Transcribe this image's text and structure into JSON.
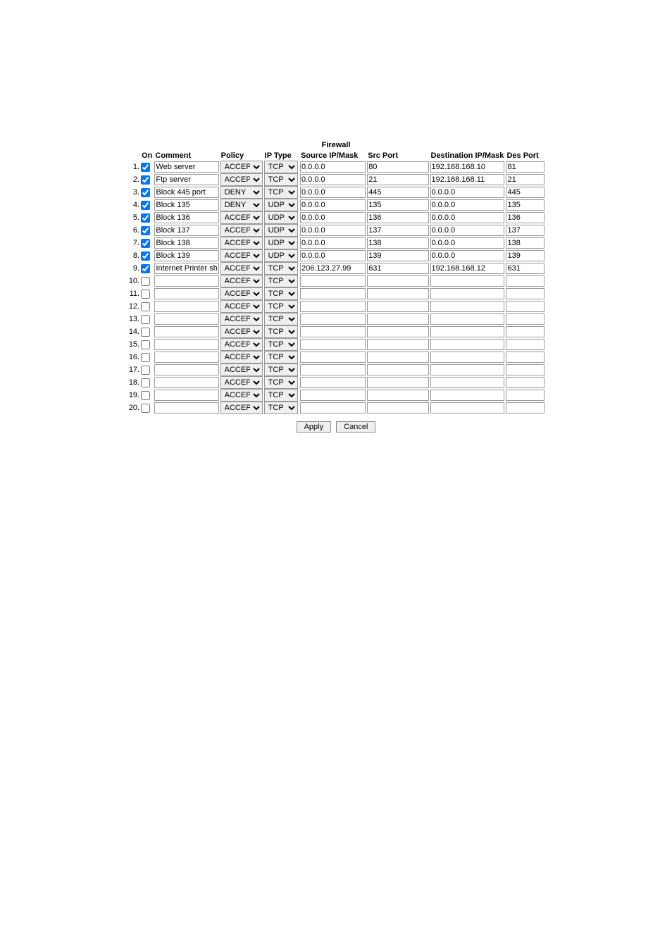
{
  "title": "Firewall",
  "headers": {
    "on": "On",
    "comment": "Comment",
    "policy": "Policy",
    "iptype": "IP Type",
    "src": "Source IP/Mask",
    "srcport": "Src Port",
    "dst": "Destination IP/Mask",
    "dstport": "Des Port"
  },
  "policy_options": [
    "ACCEPT",
    "DENY"
  ],
  "iptype_options": [
    "TCP",
    "UDP"
  ],
  "rows": [
    {
      "n": "1.",
      "on": true,
      "comment": "Web server",
      "policy": "ACCEPT",
      "iptype": "TCP",
      "src": "0.0.0.0",
      "srcport": "80",
      "dst": "192.168.168.10",
      "dstport": "81"
    },
    {
      "n": "2.",
      "on": true,
      "comment": "Ftp server",
      "policy": "ACCEPT",
      "iptype": "TCP",
      "src": "0.0.0.0",
      "srcport": "21",
      "dst": "192.168.168.11",
      "dstport": "21"
    },
    {
      "n": "3.",
      "on": true,
      "comment": "Block 445 port",
      "policy": "DENY",
      "iptype": "TCP",
      "src": "0.0.0.0",
      "srcport": "445",
      "dst": "0.0.0.0",
      "dstport": "445"
    },
    {
      "n": "4.",
      "on": true,
      "comment": "Block 135",
      "policy": "DENY",
      "iptype": "UDP",
      "src": "0.0.0.0",
      "srcport": "135",
      "dst": "0.0.0.0",
      "dstport": "135"
    },
    {
      "n": "5.",
      "on": true,
      "comment": "Block 136",
      "policy": "ACCEPT",
      "iptype": "UDP",
      "src": "0.0.0.0",
      "srcport": "136",
      "dst": "0.0.0.0",
      "dstport": "136"
    },
    {
      "n": "6.",
      "on": true,
      "comment": "Block 137",
      "policy": "ACCEPT",
      "iptype": "UDP",
      "src": "0.0.0.0",
      "srcport": "137",
      "dst": "0.0.0.0",
      "dstport": "137"
    },
    {
      "n": "7.",
      "on": true,
      "comment": "Block 138",
      "policy": "ACCEPT",
      "iptype": "UDP",
      "src": "0.0.0.0",
      "srcport": "138",
      "dst": "0.0.0.0",
      "dstport": "138"
    },
    {
      "n": "8.",
      "on": true,
      "comment": "Block 139",
      "policy": "ACCEPT",
      "iptype": "UDP",
      "src": "0.0.0.0",
      "srcport": "139",
      "dst": "0.0.0.0",
      "dstport": "139"
    },
    {
      "n": "9.",
      "on": true,
      "comment": "Internet Printer share",
      "policy": "ACCEPT",
      "iptype": "TCP",
      "src": "206.123.27.99",
      "srcport": "631",
      "dst": "192.168.168.12",
      "dstport": "631"
    },
    {
      "n": "10.",
      "on": false,
      "comment": "",
      "policy": "ACCEPT",
      "iptype": "TCP",
      "src": "",
      "srcport": "",
      "dst": "",
      "dstport": ""
    },
    {
      "n": "11.",
      "on": false,
      "comment": "",
      "policy": "ACCEPT",
      "iptype": "TCP",
      "src": "",
      "srcport": "",
      "dst": "",
      "dstport": ""
    },
    {
      "n": "12.",
      "on": false,
      "comment": "",
      "policy": "ACCEPT",
      "iptype": "TCP",
      "src": "",
      "srcport": "",
      "dst": "",
      "dstport": ""
    },
    {
      "n": "13.",
      "on": false,
      "comment": "",
      "policy": "ACCEPT",
      "iptype": "TCP",
      "src": "",
      "srcport": "",
      "dst": "",
      "dstport": ""
    },
    {
      "n": "14.",
      "on": false,
      "comment": "",
      "policy": "ACCEPT",
      "iptype": "TCP",
      "src": "",
      "srcport": "",
      "dst": "",
      "dstport": ""
    },
    {
      "n": "15.",
      "on": false,
      "comment": "",
      "policy": "ACCEPT",
      "iptype": "TCP",
      "src": "",
      "srcport": "",
      "dst": "",
      "dstport": ""
    },
    {
      "n": "16.",
      "on": false,
      "comment": "",
      "policy": "ACCEPT",
      "iptype": "TCP",
      "src": "",
      "srcport": "",
      "dst": "",
      "dstport": ""
    },
    {
      "n": "17.",
      "on": false,
      "comment": "",
      "policy": "ACCEPT",
      "iptype": "TCP",
      "src": "",
      "srcport": "",
      "dst": "",
      "dstport": ""
    },
    {
      "n": "18.",
      "on": false,
      "comment": "",
      "policy": "ACCEPT",
      "iptype": "TCP",
      "src": "",
      "srcport": "",
      "dst": "",
      "dstport": ""
    },
    {
      "n": "19.",
      "on": false,
      "comment": "",
      "policy": "ACCEPT",
      "iptype": "TCP",
      "src": "",
      "srcport": "",
      "dst": "",
      "dstport": ""
    },
    {
      "n": "20.",
      "on": false,
      "comment": "",
      "policy": "ACCEPT",
      "iptype": "TCP",
      "src": "",
      "srcport": "",
      "dst": "",
      "dstport": ""
    }
  ],
  "buttons": {
    "apply": "Apply",
    "cancel": "Cancel"
  }
}
